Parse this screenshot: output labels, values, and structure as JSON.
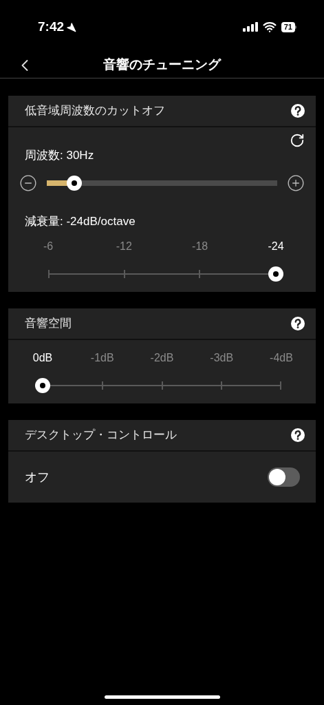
{
  "status_bar": {
    "time": "7:42",
    "battery": "71"
  },
  "header": {
    "title": "音響のチューニング"
  },
  "sections": [
    {
      "kind": "cutoff",
      "title": "低音域周波数のカットオフ",
      "frequency": {
        "label": "周波数: 30Hz",
        "level": 0.12
      },
      "attenuation": {
        "label": "減衰量: -24dB/octave",
        "ticks": [
          {
            "label": "-6",
            "selected": false
          },
          {
            "label": "-12",
            "selected": false
          },
          {
            "label": "-18",
            "selected": false
          },
          {
            "label": "-24",
            "selected": true
          }
        ]
      }
    },
    {
      "kind": "steps",
      "title": "音響空間",
      "ticks": [
        {
          "label": "0dB",
          "selected": true
        },
        {
          "label": "-1dB",
          "selected": false
        },
        {
          "label": "-2dB",
          "selected": false
        },
        {
          "label": "-3dB",
          "selected": false
        },
        {
          "label": "-4dB",
          "selected": false
        }
      ]
    },
    {
      "kind": "toggle",
      "title": "デスクトップ・コントロール",
      "label": "オフ",
      "on": false
    }
  ]
}
